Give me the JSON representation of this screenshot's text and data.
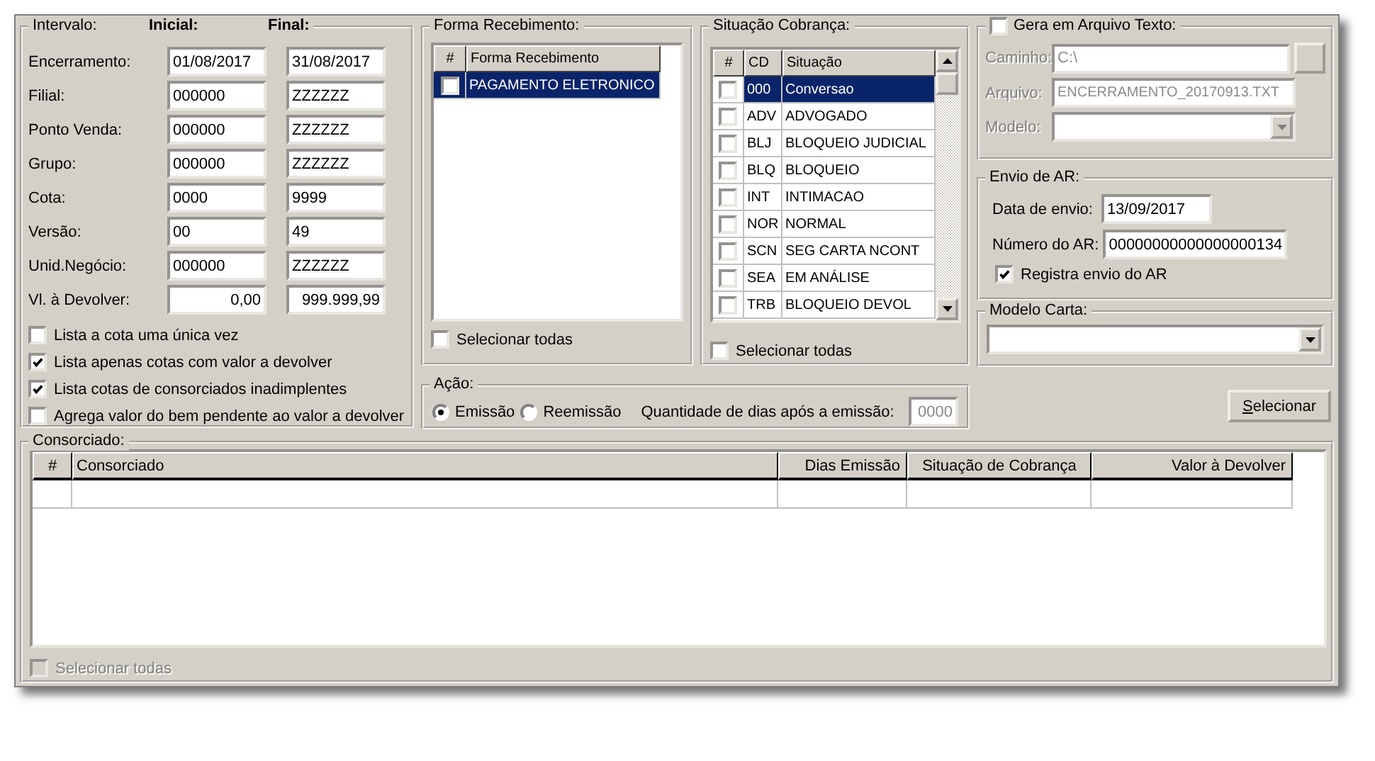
{
  "intervalo": {
    "title": "Intervalo:",
    "col_initial": "Inicial:",
    "col_final": "Final:",
    "rows": [
      {
        "label": "Encerramento:",
        "initial": "01/08/2017",
        "final": "31/08/2017"
      },
      {
        "label": "Filial:",
        "initial": "000000",
        "final": "ZZZZZZ"
      },
      {
        "label": "Ponto Venda:",
        "initial": "000000",
        "final": "ZZZZZZ"
      },
      {
        "label": "Grupo:",
        "initial": "000000",
        "final": "ZZZZZZ"
      },
      {
        "label": "Cota:",
        "initial": "0000",
        "final": "9999"
      },
      {
        "label": "Versão:",
        "initial": "00",
        "final": "49"
      },
      {
        "label": "Unid.Negócio:",
        "initial": "000000",
        "final": "ZZZZZZ"
      },
      {
        "label": "Vl. à Devolver:",
        "initial": "0,00",
        "final": "999.999,99"
      }
    ],
    "options": [
      {
        "label": "Lista a cota uma única vez",
        "checked": false
      },
      {
        "label": "Lista apenas cotas com valor a devolver",
        "checked": true
      },
      {
        "label": "Lista cotas de consorciados inadimplentes",
        "checked": true
      },
      {
        "label": "Agrega valor do bem pendente ao valor a devolver",
        "checked": false
      }
    ]
  },
  "forma_recebimento": {
    "title": "Forma Recebimento:",
    "columns": [
      "#",
      "Forma Recebimento"
    ],
    "rows": [
      {
        "name": "PAGAMENTO ELETRONICO",
        "checked": false,
        "selected": true
      }
    ],
    "select_all": {
      "label": "Selecionar todas",
      "checked": false
    }
  },
  "situacao_cobranca": {
    "title": "Situação Cobrança:",
    "columns": [
      "#",
      "CD",
      "Situação"
    ],
    "rows": [
      {
        "code": "000",
        "name": "Conversao",
        "checked": false,
        "selected": true
      },
      {
        "code": "ADV",
        "name": "ADVOGADO",
        "checked": false,
        "selected": false
      },
      {
        "code": "BLJ",
        "name": "BLOQUEIO JUDICIAL",
        "checked": false,
        "selected": false
      },
      {
        "code": "BLQ",
        "name": "BLOQUEIO",
        "checked": false,
        "selected": false
      },
      {
        "code": "INT",
        "name": "INTIMACAO",
        "checked": false,
        "selected": false
      },
      {
        "code": "NOR",
        "name": "NORMAL",
        "checked": false,
        "selected": false
      },
      {
        "code": "SCN",
        "name": "SEG CARTA NCONT",
        "checked": false,
        "selected": false
      },
      {
        "code": "SEA",
        "name": "EM ANÁLISE",
        "checked": false,
        "selected": false
      },
      {
        "code": "TRB",
        "name": "BLOQUEIO DEVOL",
        "checked": false,
        "selected": false
      }
    ],
    "select_all": {
      "label": "Selecionar todas",
      "checked": false
    }
  },
  "acao": {
    "title": "Ação:",
    "options": [
      {
        "label": "Emissão",
        "selected": true
      },
      {
        "label": "Reemissão",
        "selected": false
      }
    ],
    "days": {
      "label": "Quantidade de dias após a emissão:",
      "value": "0000",
      "disabled": true
    }
  },
  "arquivo_texto": {
    "title": "Gera em Arquivo Texto:",
    "checked": false,
    "path_label": "Caminho:",
    "path": "C:\\",
    "file_label": "Arquivo:",
    "file": "ENCERRAMENTO_20170913.TXT",
    "model_label": "Modelo:"
  },
  "envio_ar": {
    "title": "Envio de AR:",
    "date_label": "Data de envio:",
    "date": "13/09/2017",
    "number_label": "Número do AR:",
    "number": "00000000000000000134",
    "register": {
      "label": "Registra envio do AR",
      "checked": true
    }
  },
  "modelo_carta": {
    "title": "Modelo Carta:"
  },
  "select_button": "Selecionar",
  "consorciado": {
    "title": "Consorciado:",
    "columns": [
      "#",
      "Consorciado",
      "Dias Emissão",
      "Situação de Cobrança",
      "Valor à Devolver"
    ],
    "select_all": {
      "label": "Selecionar todas",
      "checked": false,
      "disabled": true
    }
  }
}
